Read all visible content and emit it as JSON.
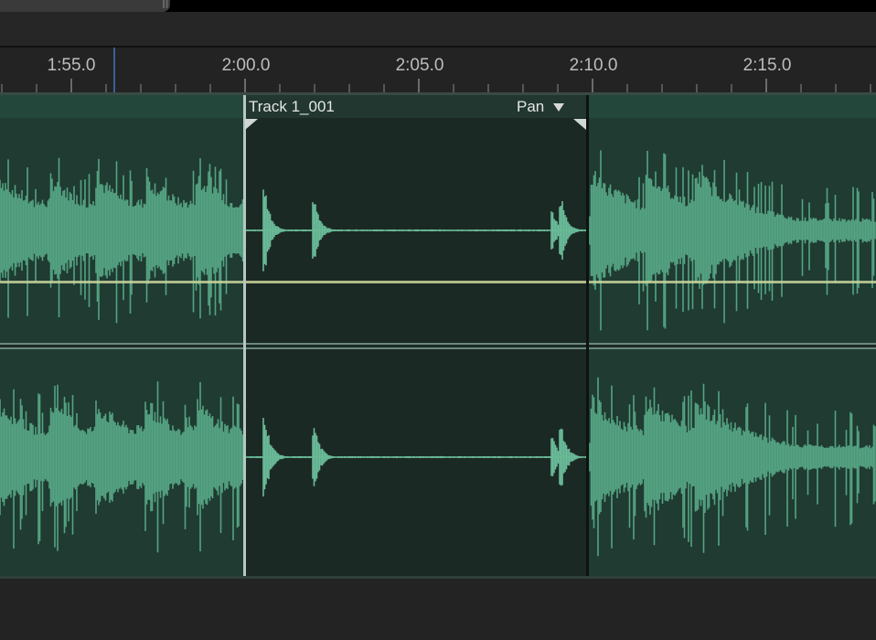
{
  "scrollbar": {
    "thumb_icon": "scrollbar-grip-icon"
  },
  "ruler": {
    "labels": [
      "1:55.0",
      "2:00.0",
      "2:05.0",
      "2:10.0",
      "2:15.0"
    ]
  },
  "clip": {
    "name": "Track 1_001",
    "pan_label": "Pan",
    "pan_icon": "chevron-down-icon"
  },
  "colors": {
    "waveform": "#55a383",
    "waveform_bright": "#6bbd9a",
    "clip_background": "#1b2924",
    "lane_background": "#1f3b32",
    "pan_line": "#c9d39a",
    "playhead": "#3b5f9c"
  }
}
